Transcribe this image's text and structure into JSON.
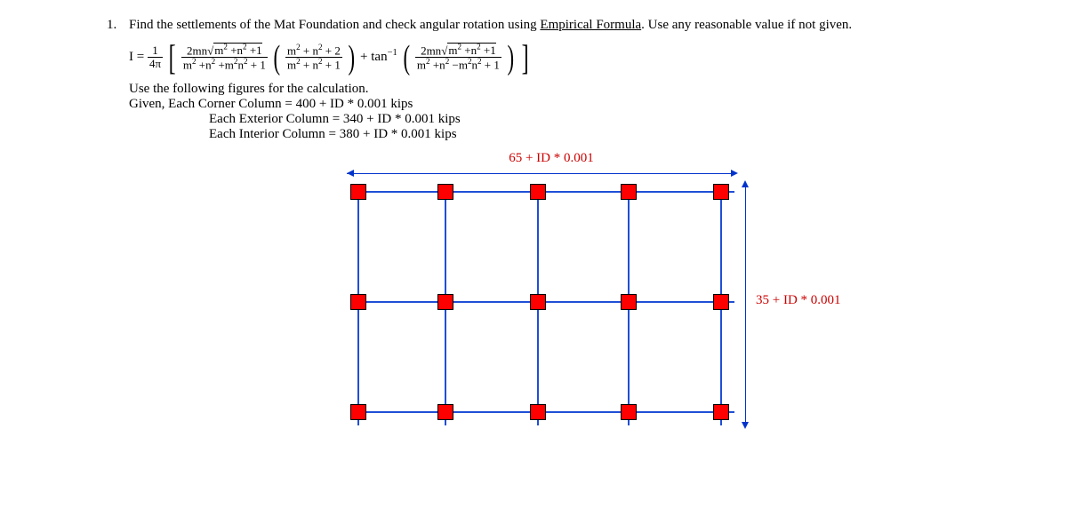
{
  "question": {
    "number": "1.",
    "prompt_plain": "Find the settlements of the Mat Foundation and check angular rotation using ",
    "prompt_underlined": "Empirical Formula",
    "prompt_tail": ". Use any reasonable value if not given."
  },
  "formula": {
    "lhs": "I =",
    "coef_num": "1",
    "coef_den": "4π",
    "term1_num": "2mn√(m² + n² + 1)",
    "term1_den": "m² + n² + m²n² + 1",
    "term2_num": "m² + n² + 2",
    "term2_den": "m² + n² + 1",
    "plus_tan": "+ tan",
    "tan_exp": "−1",
    "term3_num": "2mn√(m² + n² + 1)",
    "term3_den": "m² + n² − m²n² + 1"
  },
  "given": {
    "intro": "Use the following figures for the calculation.",
    "line1": "Given, Each Corner Column = 400 + ID * 0.001 kips",
    "line2": "Each Exterior Column = 340 + ID * 0.001 kips",
    "line3": "Each Interior Column = 380 + ID * 0.001 kips"
  },
  "diagram": {
    "top_label": "65 + ID * 0.001",
    "right_label": "35 + ID * 0.001"
  }
}
